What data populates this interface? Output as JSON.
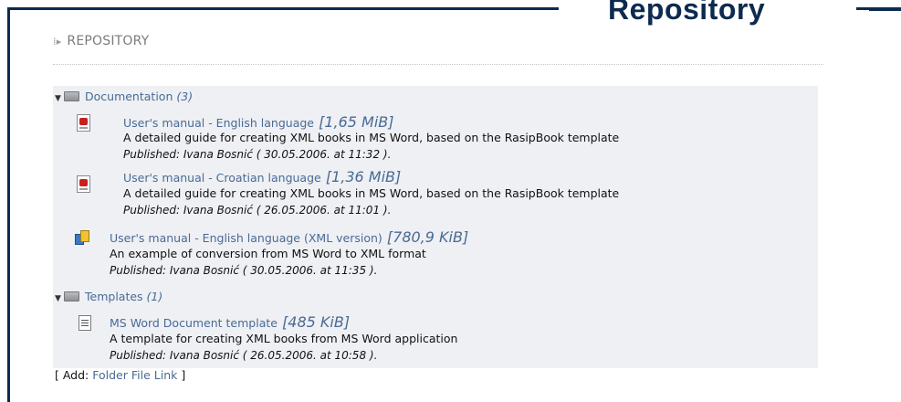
{
  "page_title": "Repository",
  "header": {
    "arrow": "⁞▸",
    "label": "REPOSITORY"
  },
  "folders": [
    {
      "name": "Documentation",
      "count": "(3)",
      "toggle": "▼",
      "files": [
        {
          "icon": "pdf-icon",
          "title": "User's manual - English language",
          "size": "[1,65 MiB]",
          "description": "A detailed guide for creating XML books in MS Word, based on the RasipBook template",
          "published": "Published: Ivana Bosnić ( 30.05.2006. at 11:32 )."
        },
        {
          "icon": "pdf-icon",
          "title": "User's manual - Croatian language",
          "size": "[1,36 MiB]",
          "description": "A detailed guide for creating XML books in MS Word, based on the RasipBook template",
          "published": "Published: Ivana Bosnić ( 26.05.2006. at 11:01 )."
        },
        {
          "icon": "xml-package-icon",
          "title": "User's manual - English language (XML version)",
          "size": "[780,9 KiB]",
          "description": "An example of conversion from MS Word to XML format",
          "published": "Published: Ivana Bosnić ( 30.05.2006. at 11:35 )."
        }
      ]
    },
    {
      "name": "Templates",
      "count": "(1)",
      "toggle": "▼",
      "files": [
        {
          "icon": "word-template-icon",
          "title": "MS Word Document template",
          "size": "[485 KiB]",
          "description": "A template for creating XML books from MS Word application",
          "published": "Published: Ivana Bosnić ( 26.05.2006. at 10:58 )."
        }
      ]
    }
  ],
  "add": {
    "prefix": "[ Add:",
    "folder": "Folder",
    "file": "File",
    "link": "Link",
    "suffix": "]"
  },
  "colors": {
    "frame": "#0d2a4f",
    "link": "#4a6a94",
    "panel": "#eef0f4"
  }
}
